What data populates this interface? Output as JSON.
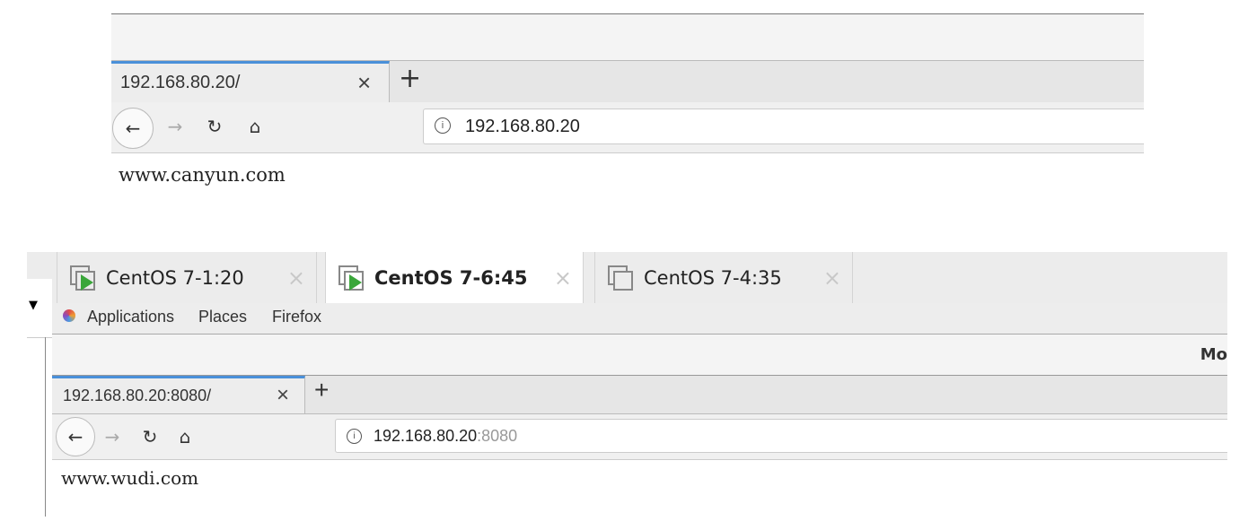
{
  "top_browser": {
    "tab_title": "192.168.80.20/",
    "close_tab": "×",
    "new_tab": "+",
    "url": "192.168.80.20",
    "page_text": "www.canyun.com",
    "accent_color": "#4a90d9"
  },
  "vm_tabs": [
    {
      "label": "CentOS 7-1:20",
      "active": false,
      "running": true,
      "close": "×"
    },
    {
      "label": "CentOS 7-6:45",
      "active": true,
      "running": true,
      "close": "×"
    },
    {
      "label": "CentOS 7-4:35",
      "active": false,
      "running": false,
      "close": "×"
    }
  ],
  "gnome_bar": {
    "applications": "Applications",
    "places": "Places",
    "firefox": "Firefox"
  },
  "window_title_partial": "Mo",
  "bottom_browser": {
    "tab_title": "192.168.80.20:8080/",
    "close_tab": "×",
    "new_tab": "+",
    "url_host": "192.168.80.20",
    "url_port": ":8080",
    "page_text": "www.wudi.com"
  }
}
